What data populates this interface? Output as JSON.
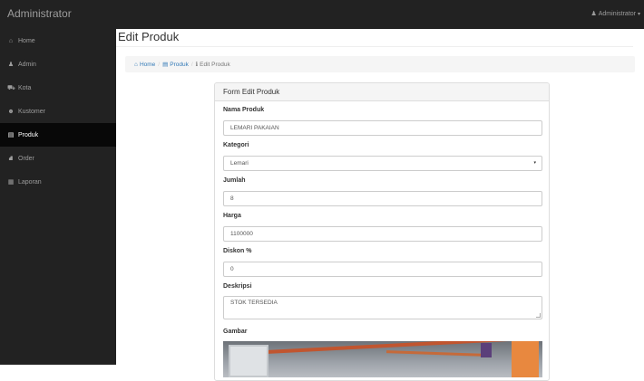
{
  "navbar": {
    "brand": "Administrator",
    "user_label": "Administrator",
    "user_caret": "▾"
  },
  "sidebar": {
    "items": [
      {
        "label": "Home",
        "icon": "⌂"
      },
      {
        "label": "Admin",
        "icon": "♟"
      },
      {
        "label": "Kota",
        "icon": "⛟"
      },
      {
        "label": "Kustomer",
        "icon": "☻"
      },
      {
        "label": "Produk",
        "icon": "▤"
      },
      {
        "label": "Order",
        "icon": "⛘"
      },
      {
        "label": "Laporan",
        "icon": "▦"
      }
    ],
    "active_index": 4
  },
  "page": {
    "title": "Edit Produk"
  },
  "breadcrumb": {
    "home": "Home",
    "home_icon": "⌂",
    "produk": "Produk",
    "produk_icon": "▤",
    "current": "Edit Produk",
    "current_icon": "ℹ",
    "separator": "/"
  },
  "form": {
    "heading": "Form Edit Produk",
    "nama_label": "Nama Produk",
    "nama_value": "LEMARI PAKAIAN",
    "kategori_label": "Kategori",
    "kategori_value": "Lemari",
    "kategori_arrow": "▾",
    "jumlah_label": "Jumlah",
    "jumlah_value": "8",
    "harga_label": "Harga",
    "harga_value": "1100000",
    "diskon_label": "Diskon %",
    "diskon_value": "0",
    "deskripsi_label": "Deskripsi",
    "deskripsi_value": "STOK TERSEDIA",
    "gambar_label": "Gambar"
  },
  "colors": {
    "navbar_bg": "#222222",
    "sidebar_active_bg": "#080808",
    "link": "#337ab7"
  }
}
